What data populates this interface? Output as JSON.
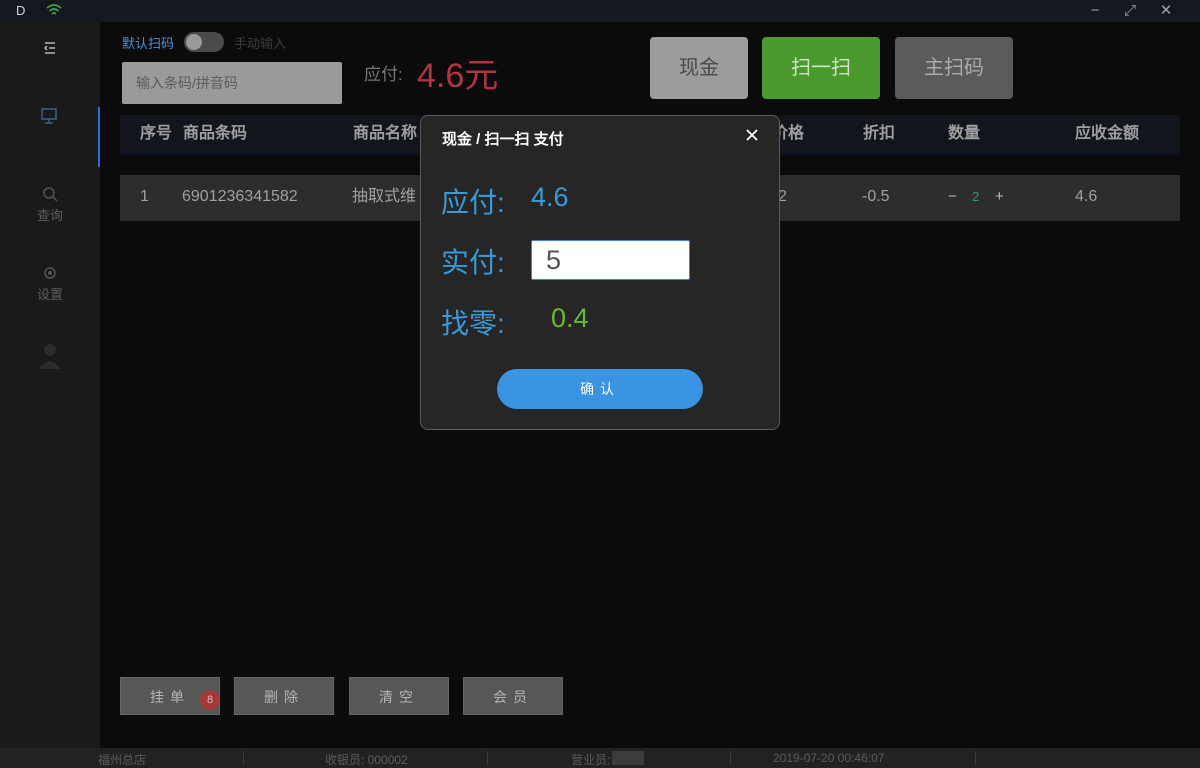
{
  "titlebar": {
    "logo": "D",
    "minimize_glyph": "−",
    "maximize_glyph": "⤢",
    "close_glyph": "✕"
  },
  "sidebar": {
    "items": [
      {
        "label": "",
        "icon": "cashier-icon"
      },
      {
        "label": "查询",
        "icon": "search-icon"
      },
      {
        "label": "设置",
        "icon": "gear-icon"
      },
      {
        "label": "",
        "icon": "user-icon"
      }
    ]
  },
  "header": {
    "mode_default": "默认扫码",
    "mode_manual": "手动输入",
    "barcode_placeholder": "输入条码/拼音码",
    "due_label": "应付:",
    "due_amount": "4.6元",
    "pay_cash": "现金",
    "pay_scan": "扫一扫",
    "pay_main": "主扫码"
  },
  "table": {
    "columns": [
      "序号",
      "商品条码",
      "商品名称",
      "价格",
      "折扣",
      "数量",
      "应收金额"
    ],
    "rows": [
      {
        "index": "1",
        "barcode": "6901236341582",
        "name": "抽取式维",
        "price": "2",
        "discount": "-0.5",
        "qty_minus": "−",
        "qty": "2",
        "qty_plus": "+",
        "amount": "4.6"
      }
    ]
  },
  "footer_buttons": {
    "hold": "挂单",
    "hold_badge": "8",
    "delete": "删除",
    "clear": "清空",
    "member": "会员"
  },
  "statusbar": {
    "store": "福州总店",
    "cashier": "收银员: 000002",
    "salesperson": "营业员:",
    "datetime": "2019-07-20 00:46:07"
  },
  "modal": {
    "title": "现金 / 扫一扫 支付",
    "due_label": "应付:",
    "due_value": "4.6",
    "paid_label": "实付:",
    "paid_value": "5",
    "change_label": "找零:",
    "change_value": "0.4",
    "confirm": "确认"
  },
  "colors": {
    "accent_blue": "#3a9ad8",
    "scan_green": "#4a9a2e",
    "due_red": "#b23344",
    "change_green": "#6aba2e"
  }
}
